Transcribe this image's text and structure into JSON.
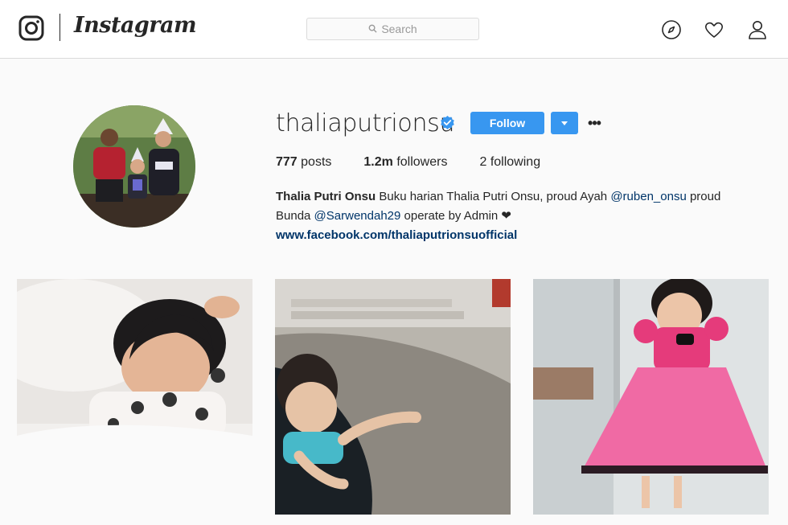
{
  "nav": {
    "brand": "Instagram",
    "search_placeholder": "Search",
    "icons": [
      "instagram-camera-icon",
      "search-icon",
      "compass-icon",
      "heart-icon",
      "user-icon"
    ]
  },
  "profile": {
    "username": "thaliaputrionsu",
    "verified": true,
    "follow_label": "Follow",
    "more_label": "•••",
    "stats": {
      "posts_count": "777",
      "posts_label": "posts",
      "followers_count": "1.2m",
      "followers_label": "followers",
      "following_count": "2",
      "following_label": "following"
    },
    "bio": {
      "full_name": "Thalia Putri Onsu",
      "text_1": " Buku harian Thalia Putri Onsu, proud Ayah ",
      "mention_1": "@ruben_onsu",
      "text_2": " proud Bunda ",
      "mention_2": "@Sarwendah29",
      "text_3": " operate by Admin ❤",
      "link": "www.facebook.com/thaliaputrionsuofficial"
    }
  },
  "colors": {
    "accent": "#3897f0",
    "link": "#003569",
    "border": "#dbdbdb",
    "background": "#fafafa"
  }
}
